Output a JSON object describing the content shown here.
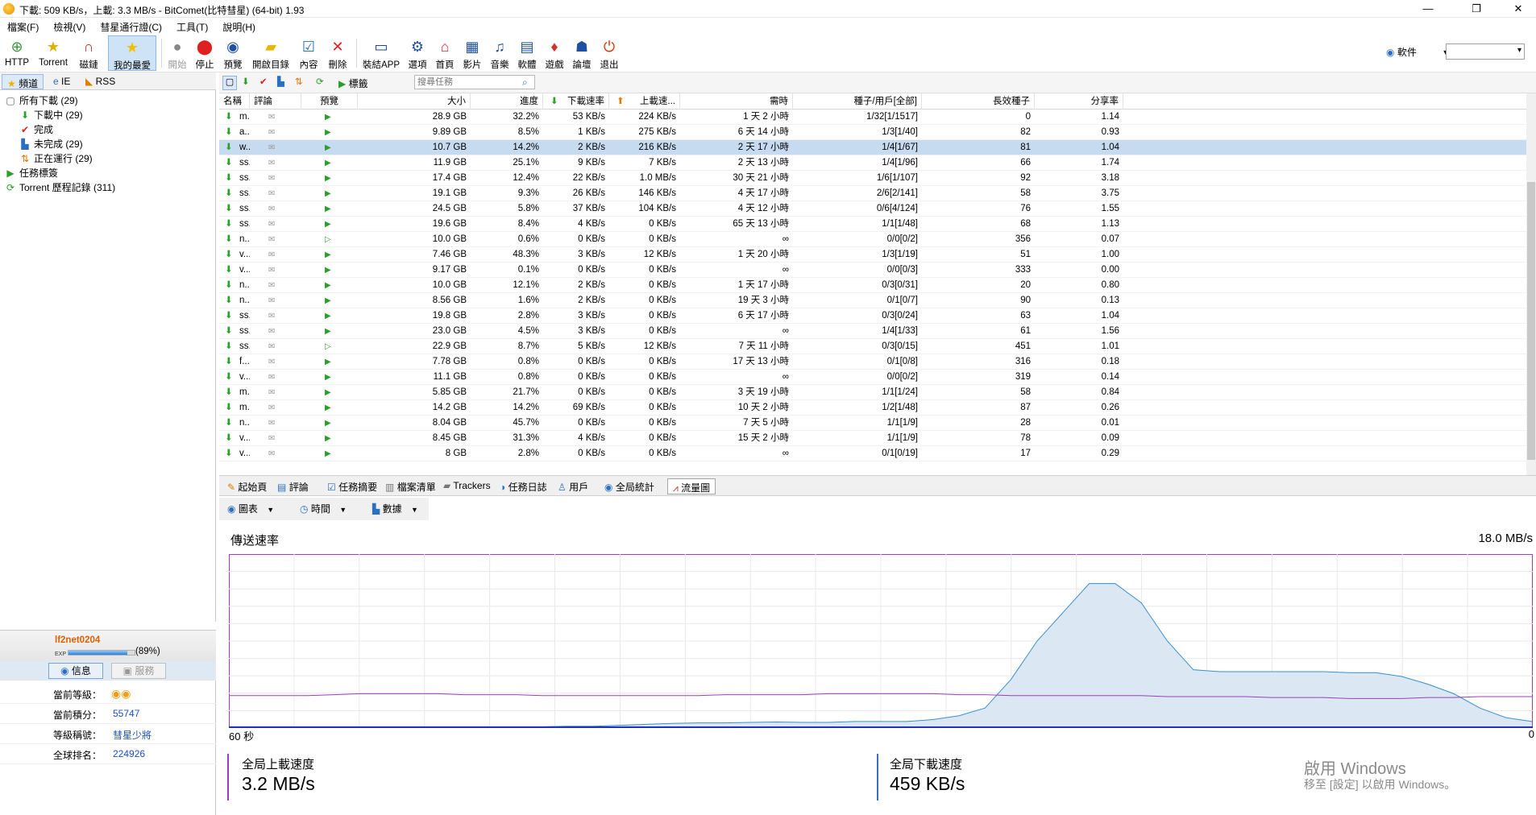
{
  "window": {
    "title": "下載: 509 KB/s，上載: 3.3 MB/s - BitComet(比特彗星) (64-bit) 1.93"
  },
  "menu": [
    "檔案(F)",
    "檢視(V)",
    "彗星通行證(C)",
    "工具(T)",
    "說明(H)"
  ],
  "toolbar": {
    "buttons": [
      {
        "label": "HTTP",
        "icon": "http-add-icon"
      },
      {
        "label": "Torrent",
        "icon": "torrent-add-icon"
      },
      {
        "label": "磁鏈",
        "icon": "magnet-icon"
      },
      {
        "label": "我的最愛",
        "icon": "favorites-star-icon"
      },
      {
        "label": "開始",
        "icon": "start-icon"
      },
      {
        "label": "停止",
        "icon": "stop-icon"
      },
      {
        "label": "預覽",
        "icon": "preview-icon"
      },
      {
        "label": "開啟目錄",
        "icon": "open-folder-icon"
      },
      {
        "label": "內容",
        "icon": "properties-icon"
      },
      {
        "label": "刪除",
        "icon": "delete-icon"
      },
      {
        "label": "裝結APP",
        "icon": "app-icon"
      },
      {
        "label": "選項",
        "icon": "options-icon"
      },
      {
        "label": "首頁",
        "icon": "home-icon"
      },
      {
        "label": "影片",
        "icon": "video-icon"
      },
      {
        "label": "音樂",
        "icon": "music-icon"
      },
      {
        "label": "軟體",
        "icon": "software-icon"
      },
      {
        "label": "遊戲",
        "icon": "game-icon"
      },
      {
        "label": "論壇",
        "icon": "forum-icon"
      },
      {
        "label": "退出",
        "icon": "exit-icon"
      }
    ],
    "right_label": "軟件"
  },
  "left": {
    "tabs": [
      "頻道",
      "IE",
      "RSS"
    ],
    "tree": [
      {
        "label": "所有下載 (29)",
        "icon": "all-downloads-icon",
        "indent": 0
      },
      {
        "label": "下載中 (29)",
        "icon": "downloading-icon",
        "indent": 1
      },
      {
        "label": "完成",
        "icon": "completed-icon",
        "indent": 1
      },
      {
        "label": "未完成 (29)",
        "icon": "incomplete-icon",
        "indent": 1
      },
      {
        "label": "正在運行 (29)",
        "icon": "running-icon",
        "indent": 1
      },
      {
        "label": "任務標簽",
        "icon": "task-tag-icon",
        "indent": 0
      },
      {
        "label": "Torrent 歷程記錄 (311)",
        "icon": "history-icon",
        "indent": 0
      }
    ]
  },
  "user": {
    "name": "lf2net0204",
    "exp_label": "EXP",
    "exp_percent": "(89%)",
    "exp_fraction": 0.89,
    "info_button": "信息",
    "service_button": "服務",
    "fields": [
      {
        "label": "當前等級：",
        "value": ""
      },
      {
        "label": "當前積分：",
        "value": "55747"
      },
      {
        "label": "等級稱號：",
        "value": "彗星少將"
      },
      {
        "label": "全球排名：",
        "value": "224926"
      }
    ]
  },
  "list": {
    "toolbar": {
      "tag_label": "標籤",
      "search_placeholder": "搜尋任務"
    },
    "columns": [
      "名稱",
      "評論",
      "預覽",
      "大小",
      "進度",
      "下載速率",
      "上載速...",
      "需時",
      "種子/用戶[全部]",
      "長效種子",
      "分享率"
    ],
    "rows": [
      [
        "m...",
        "28.9 GB",
        "32.2%",
        "53 KB/s",
        "224 KB/s",
        "1 天 2 小時",
        "1/32[1/1517]",
        "0",
        "1.14"
      ],
      [
        "a...",
        "9.89 GB",
        "8.5%",
        "1 KB/s",
        "275 KB/s",
        "6 天 14 小時",
        "1/3[1/40]",
        "82",
        "0.93"
      ],
      [
        "w...",
        "10.7 GB",
        "14.2%",
        "2 KB/s",
        "216 KB/s",
        "2 天 17 小時",
        "1/4[1/67]",
        "81",
        "1.04"
      ],
      [
        "ss...",
        "11.9 GB",
        "25.1%",
        "9 KB/s",
        "7 KB/s",
        "2 天 13 小時",
        "1/4[1/96]",
        "66",
        "1.74"
      ],
      [
        "ss...",
        "17.4 GB",
        "12.4%",
        "22 KB/s",
        "1.0 MB/s",
        "30 天 21 小時",
        "1/6[1/107]",
        "92",
        "3.18"
      ],
      [
        "ss...",
        "19.1 GB",
        "9.3%",
        "26 KB/s",
        "146 KB/s",
        "4 天 17 小時",
        "2/6[2/141]",
        "58",
        "3.75"
      ],
      [
        "ss...",
        "24.5 GB",
        "5.8%",
        "37 KB/s",
        "104 KB/s",
        "4 天 12 小時",
        "0/6[4/124]",
        "76",
        "1.55"
      ],
      [
        "ss...",
        "19.6 GB",
        "8.4%",
        "4 KB/s",
        "0 KB/s",
        "65 天 13 小時",
        "1/1[1/48]",
        "68",
        "1.13"
      ],
      [
        "n...",
        "10.0 GB",
        "0.6%",
        "0 KB/s",
        "0 KB/s",
        "∞",
        "0/0[0/2]",
        "356",
        "0.07"
      ],
      [
        "v...",
        "7.46 GB",
        "48.3%",
        "3 KB/s",
        "12 KB/s",
        "1 天 20 小時",
        "1/3[1/19]",
        "51",
        "1.00"
      ],
      [
        "v...",
        "9.17 GB",
        "0.1%",
        "0 KB/s",
        "0 KB/s",
        "∞",
        "0/0[0/3]",
        "333",
        "0.00"
      ],
      [
        "n...",
        "10.0 GB",
        "12.1%",
        "2 KB/s",
        "0 KB/s",
        "1 天 17 小時",
        "0/3[0/31]",
        "20",
        "0.80"
      ],
      [
        "n...",
        "8.56 GB",
        "1.6%",
        "2 KB/s",
        "0 KB/s",
        "19 天 3 小時",
        "0/1[0/7]",
        "90",
        "0.13"
      ],
      [
        "ss...",
        "19.8 GB",
        "2.8%",
        "3 KB/s",
        "0 KB/s",
        "6 天 17 小時",
        "0/3[0/24]",
        "63",
        "1.04"
      ],
      [
        "ss...",
        "23.0 GB",
        "4.5%",
        "3 KB/s",
        "0 KB/s",
        "∞",
        "1/4[1/33]",
        "61",
        "1.56"
      ],
      [
        "ss...",
        "22.9 GB",
        "8.7%",
        "5 KB/s",
        "12 KB/s",
        "7 天 11 小時",
        "0/3[0/15]",
        "451",
        "1.01"
      ],
      [
        "f...",
        "7.78 GB",
        "0.8%",
        "0 KB/s",
        "0 KB/s",
        "17 天 13 小時",
        "0/1[0/8]",
        "316",
        "0.18"
      ],
      [
        "v...",
        "11.1 GB",
        "0.8%",
        "0 KB/s",
        "0 KB/s",
        "∞",
        "0/0[0/2]",
        "319",
        "0.14"
      ],
      [
        "m...",
        "5.85 GB",
        "21.7%",
        "0 KB/s",
        "0 KB/s",
        "3 天 19 小時",
        "1/1[1/24]",
        "58",
        "0.84"
      ],
      [
        "m...",
        "14.2 GB",
        "14.2%",
        "69 KB/s",
        "0 KB/s",
        "10 天 2 小時",
        "1/2[1/48]",
        "87",
        "0.26"
      ],
      [
        "n...",
        "8.04 GB",
        "45.7%",
        "0 KB/s",
        "0 KB/s",
        "7 天 5 小時",
        "1/1[1/9]",
        "28",
        "0.01"
      ],
      [
        "v...",
        "8.45 GB",
        "31.3%",
        "4 KB/s",
        "0 KB/s",
        "15 天 2 小時",
        "1/1[1/9]",
        "78",
        "0.09"
      ],
      [
        "v...",
        "8 GB",
        "2.8%",
        "0 KB/s",
        "0 KB/s",
        "∞",
        "0/1[0/19]",
        "17",
        "0.29"
      ]
    ],
    "selected_row": 2
  },
  "bottom_tabs": [
    "起始頁",
    "評論",
    "任務摘要",
    "檔案清單",
    "Trackers",
    "任務日誌",
    "用戶",
    "全局統計",
    "流量圖"
  ],
  "graph_tools": [
    "圖表",
    "時間",
    "數據"
  ],
  "graph": {
    "title": "傳送速率",
    "max_label": "18.0 MB/s",
    "x_left_label": "60 秒",
    "x_right_label": "0",
    "upload_color": "#9b3fbf",
    "download_color": "#3a8fd0",
    "download_values_mbs": [
      0.05,
      0.05,
      0.05,
      0.05,
      0.05,
      0.05,
      0.05,
      0.05,
      0.05,
      0.05,
      0.05,
      0.05,
      0.05,
      0.1,
      0.1,
      0.2,
      0.3,
      0.4,
      0.45,
      0.45,
      0.5,
      0.55,
      0.5,
      0.5,
      0.6,
      0.6,
      0.6,
      0.8,
      1.2,
      2,
      5,
      9,
      12,
      15,
      15,
      13,
      9,
      6,
      5.8,
      5.8,
      5.8,
      5.8,
      5.8,
      5.7,
      5.7,
      5.3,
      4.5,
      3.5,
      2,
      1,
      0.6
    ],
    "upload_values_mbs": [
      3.3,
      3.3,
      3.3,
      3.3,
      3.4,
      3.5,
      3.5,
      3.5,
      3.5,
      3.4,
      3.4,
      3.4,
      3.3,
      3.3,
      3.3,
      3.3,
      3.3,
      3.3,
      3.3,
      3.4,
      3.4,
      3.4,
      3.4,
      3.5,
      3.5,
      3.5,
      3.5,
      3.5,
      3.4,
      3.4,
      3.3,
      3.3,
      3.3,
      3.3,
      3.3,
      3.3,
      3.2,
      3.2,
      3.2,
      3.2,
      3.1,
      3.1,
      3.1,
      3.0,
      3.0,
      3.0,
      3.1,
      3.1,
      3.2,
      3.2,
      3.2
    ]
  },
  "stats": {
    "upload_label": "全局上載速度",
    "upload_value": "3.2 MB/s",
    "download_label": "全局下載速度",
    "download_value": "459 KB/s"
  },
  "watermark": {
    "line1": "啟用 Windows",
    "line2": "移至 [設定] 以啟用 Windows。"
  }
}
